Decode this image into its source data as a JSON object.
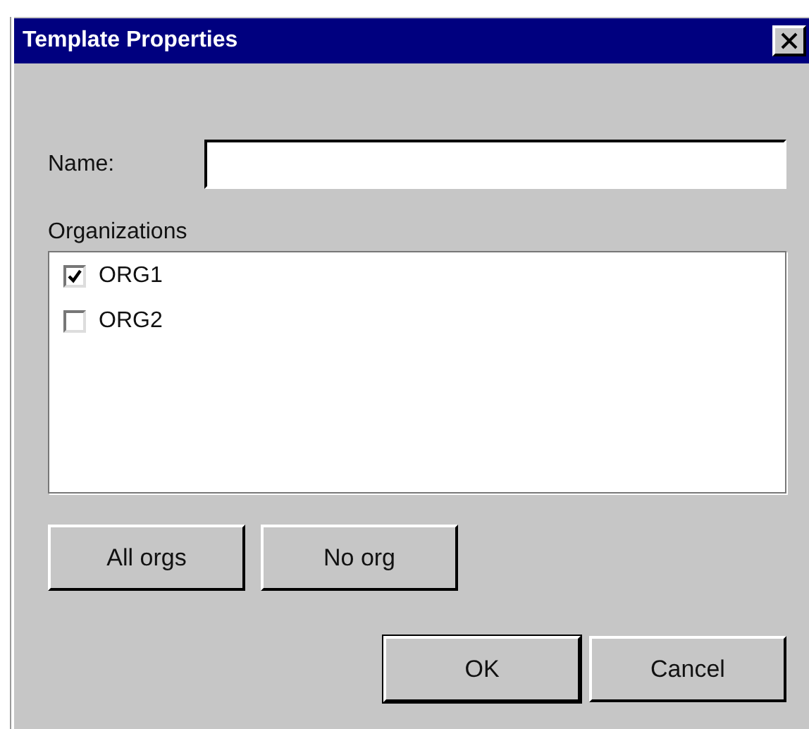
{
  "window": {
    "title": "Template Properties"
  },
  "name_field": {
    "label": "Name:"
  },
  "organizations": {
    "label": "Organizations",
    "items": [
      {
        "label": "ORG1",
        "checked": true
      },
      {
        "label": "ORG2",
        "checked": false
      }
    ]
  },
  "org_buttons": [
    "All orgs",
    "No org"
  ],
  "buttons": [
    {
      "label": "OK",
      "default": true
    },
    {
      "label": "Cancel",
      "default": false
    }
  ]
}
